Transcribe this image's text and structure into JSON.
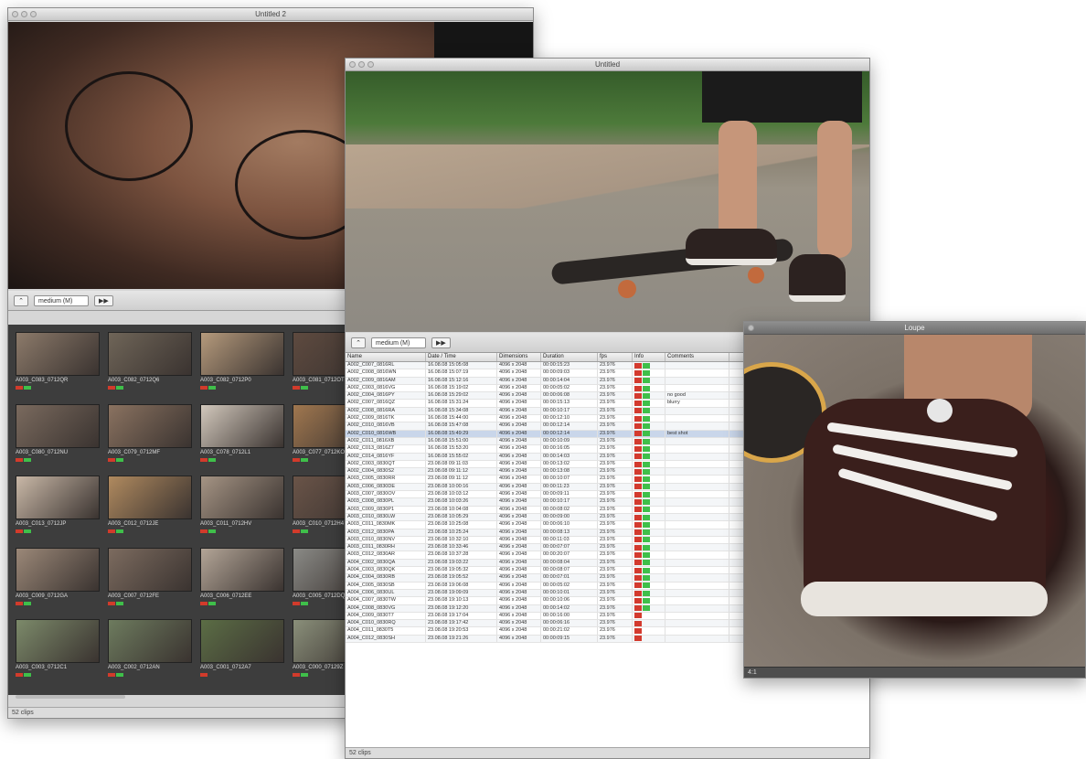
{
  "window1": {
    "title": "Untitled 2",
    "toolbar": {
      "btn1": "⌃",
      "size": "medium (M)",
      "btn2": "▶▶"
    },
    "clips": [
      {
        "name": "A003_C083_0712QR",
        "tags": [
          "r",
          "g"
        ]
      },
      {
        "name": "A003_C082_0712Q6",
        "tags": [
          "r",
          "g"
        ]
      },
      {
        "name": "A003_C082_0712P0",
        "tags": [
          "r",
          "g"
        ]
      },
      {
        "name": "A003_C081_0712OT",
        "tags": [
          "r",
          "g"
        ]
      },
      {
        "name": "A003_C080_0712NU",
        "tags": [
          "r",
          "g"
        ]
      },
      {
        "name": "A003_C079_0712MF",
        "tags": [
          "r",
          "g"
        ]
      },
      {
        "name": "A003_C078_0712L1",
        "tags": [
          "r",
          "g"
        ]
      },
      {
        "name": "A003_C077_0712KO",
        "tags": [
          "r",
          "g"
        ]
      },
      {
        "name": "A003_C013_0712JP",
        "tags": [
          "r",
          "g"
        ]
      },
      {
        "name": "A003_C012_0712JE",
        "tags": [
          "r",
          "g"
        ]
      },
      {
        "name": "A003_C011_0712HV",
        "tags": [
          "r",
          "g"
        ]
      },
      {
        "name": "A003_C010_0712H4",
        "tags": [
          "r",
          "g"
        ]
      },
      {
        "name": "A003_C009_0712GA",
        "tags": [
          "r",
          "g"
        ]
      },
      {
        "name": "A003_C007_0712FE",
        "tags": [
          "r",
          "g"
        ]
      },
      {
        "name": "A003_C006_0712EE",
        "tags": [
          "r",
          "g"
        ]
      },
      {
        "name": "A003_C005_0712DQ",
        "tags": [
          "r",
          "g"
        ]
      },
      {
        "name": "A003_C003_0712C1",
        "tags": [
          "r",
          "g"
        ]
      },
      {
        "name": "A003_C002_0712AN",
        "tags": [
          "r",
          "g"
        ]
      },
      {
        "name": "A003_C001_0712A7",
        "tags": [
          "r"
        ]
      },
      {
        "name": "A003_C000_07129Z",
        "tags": [
          "r",
          "g"
        ]
      }
    ],
    "status": "52 clips"
  },
  "window2": {
    "title": "Untitled",
    "toolbar": {
      "btn1": "⌃",
      "size": "medium (M)",
      "btn2": "▶▶"
    },
    "columns": [
      "Name",
      "Date / Time",
      "Dimensions",
      "Duration",
      "fps",
      "Info",
      "Comments"
    ],
    "rows": [
      {
        "name": "A002_C007_0816RL",
        "date": "16.08.08 15:05:08",
        "dim": "4096 x 2048",
        "dur": "00:00:15:23",
        "fps": "23.976",
        "tags": [
          "r",
          "g"
        ],
        "comment": ""
      },
      {
        "name": "A002_C008_0816WN",
        "date": "16.08.08 15:07:19",
        "dim": "4096 x 2048",
        "dur": "00:00:09:03",
        "fps": "23.976",
        "tags": [
          "r",
          "g"
        ],
        "comment": ""
      },
      {
        "name": "A002_C009_0816AM",
        "date": "16.08.08 15:12:16",
        "dim": "4096 x 2048",
        "dur": "00:00:14:04",
        "fps": "23.976",
        "tags": [
          "r",
          "g"
        ],
        "comment": ""
      },
      {
        "name": "A002_C003_0816VG",
        "date": "16.08.08 15:19:02",
        "dim": "4096 x 2048",
        "dur": "00:00:05:02",
        "fps": "23.976",
        "tags": [
          "r",
          "g"
        ],
        "comment": ""
      },
      {
        "name": "A002_C004_0816PY",
        "date": "16.08.08 15:29:02",
        "dim": "4096 x 2048",
        "dur": "00:00:06:08",
        "fps": "23.976",
        "tags": [
          "r",
          "g"
        ],
        "comment": "no good"
      },
      {
        "name": "A002_C007_0816QZ",
        "date": "16.08.08 15:31:24",
        "dim": "4096 x 2048",
        "dur": "00:00:15:13",
        "fps": "23.976",
        "tags": [
          "r",
          "g"
        ],
        "comment": "blurry"
      },
      {
        "name": "A002_C008_0816RA",
        "date": "16.08.08 15:34:08",
        "dim": "4096 x 2048",
        "dur": "00:00:10:17",
        "fps": "23.976",
        "tags": [
          "r",
          "g"
        ],
        "comment": ""
      },
      {
        "name": "A002_C009_0816TK",
        "date": "16.08.08 15:44:00",
        "dim": "4096 x 2048",
        "dur": "00:00:12:10",
        "fps": "23.976",
        "tags": [
          "r",
          "g"
        ],
        "comment": ""
      },
      {
        "name": "A002_C010_0816VB",
        "date": "16.08.08 15:47:08",
        "dim": "4096 x 2048",
        "dur": "00:00:12:14",
        "fps": "23.976",
        "tags": [
          "r",
          "g"
        ],
        "comment": ""
      },
      {
        "name": "A002_C010_0816WB",
        "date": "16.08.08 15:49:29",
        "dim": "4096 x 2048",
        "dur": "00:00:12:14",
        "fps": "23.976",
        "tags": [
          "r",
          "g"
        ],
        "comment": "best shot",
        "selected": true
      },
      {
        "name": "A002_C011_0816XB",
        "date": "16.08.08 15:51:00",
        "dim": "4096 x 2048",
        "dur": "00:00:10:09",
        "fps": "23.976",
        "tags": [
          "r",
          "g"
        ],
        "comment": ""
      },
      {
        "name": "A002_C013_0816Z7",
        "date": "16.08.08 15:53:20",
        "dim": "4096 x 2048",
        "dur": "00:00:16:05",
        "fps": "23.976",
        "tags": [
          "r",
          "g"
        ],
        "comment": ""
      },
      {
        "name": "A002_C014_0816YF",
        "date": "16.08.08 15:55:02",
        "dim": "4096 x 2048",
        "dur": "00:00:14:03",
        "fps": "23.976",
        "tags": [
          "r",
          "g"
        ],
        "comment": ""
      },
      {
        "name": "A002_C003_0830QT",
        "date": "23.08.08 09:11:03",
        "dim": "4096 x 2048",
        "dur": "00:00:13:02",
        "fps": "23.976",
        "tags": [
          "r",
          "g"
        ],
        "comment": ""
      },
      {
        "name": "A002_C004_0830S2",
        "date": "23.08.08 09:11:12",
        "dim": "4096 x 2048",
        "dur": "00:00:13:08",
        "fps": "23.976",
        "tags": [
          "r",
          "g"
        ],
        "comment": ""
      },
      {
        "name": "A003_C005_0830RR",
        "date": "23.08.08 09:11:12",
        "dim": "4096 x 2048",
        "dur": "00:00:10:07",
        "fps": "23.976",
        "tags": [
          "r",
          "g"
        ],
        "comment": ""
      },
      {
        "name": "A003_C006_0830DE",
        "date": "23.08.08 10:00:16",
        "dim": "4096 x 2048",
        "dur": "00:00:11:23",
        "fps": "23.976",
        "tags": [
          "r",
          "g"
        ],
        "comment": ""
      },
      {
        "name": "A003_C007_0830OV",
        "date": "23.08.08 10:03:12",
        "dim": "4096 x 2048",
        "dur": "00:00:09:11",
        "fps": "23.976",
        "tags": [
          "r",
          "g"
        ],
        "comment": ""
      },
      {
        "name": "A003_C008_0830PL",
        "date": "23.08.08 10:03:26",
        "dim": "4096 x 2048",
        "dur": "00:00:10:17",
        "fps": "23.976",
        "tags": [
          "r",
          "g"
        ],
        "comment": ""
      },
      {
        "name": "A003_C009_0830P1",
        "date": "23.08.08 10:04:08",
        "dim": "4096 x 2048",
        "dur": "00:00:08:02",
        "fps": "23.976",
        "tags": [
          "r",
          "g"
        ],
        "comment": ""
      },
      {
        "name": "A003_C010_0830LW",
        "date": "23.08.08 10:05:29",
        "dim": "4096 x 2048",
        "dur": "00:00:09:00",
        "fps": "23.976",
        "tags": [
          "r",
          "g"
        ],
        "comment": ""
      },
      {
        "name": "A003_C011_0830MK",
        "date": "23.08.08 10:25:08",
        "dim": "4096 x 2048",
        "dur": "00:00:06:10",
        "fps": "23.976",
        "tags": [
          "r",
          "g"
        ],
        "comment": ""
      },
      {
        "name": "A003_C012_0830PA",
        "date": "23.08.08 10:25:24",
        "dim": "4096 x 2048",
        "dur": "00:00:08:13",
        "fps": "23.976",
        "tags": [
          "r",
          "g"
        ],
        "comment": ""
      },
      {
        "name": "A003_C010_0830NV",
        "date": "23.08.08 10:32:10",
        "dim": "4096 x 2048",
        "dur": "00:00:11:03",
        "fps": "23.976",
        "tags": [
          "r",
          "g"
        ],
        "comment": ""
      },
      {
        "name": "A003_C011_0830RH",
        "date": "23.08.08 10:33:46",
        "dim": "4096 x 2048",
        "dur": "00:00:07:07",
        "fps": "23.976",
        "tags": [
          "r",
          "g"
        ],
        "comment": ""
      },
      {
        "name": "A003_C012_0830AR",
        "date": "23.08.08 10:37:28",
        "dim": "4096 x 2048",
        "dur": "00:00:20:07",
        "fps": "23.976",
        "tags": [
          "r",
          "g"
        ],
        "comment": ""
      },
      {
        "name": "A004_C002_0830QA",
        "date": "23.08.08 19:03:22",
        "dim": "4096 x 2048",
        "dur": "00:00:08:04",
        "fps": "23.976",
        "tags": [
          "r",
          "g"
        ],
        "comment": ""
      },
      {
        "name": "A004_C003_0830QK",
        "date": "23.08.08 19:05:32",
        "dim": "4096 x 2048",
        "dur": "00:00:08:07",
        "fps": "23.976",
        "tags": [
          "r",
          "g"
        ],
        "comment": ""
      },
      {
        "name": "A004_C004_0830RB",
        "date": "23.08.08 19:05:52",
        "dim": "4096 x 2048",
        "dur": "00:00:07:01",
        "fps": "23.976",
        "tags": [
          "r",
          "g"
        ],
        "comment": ""
      },
      {
        "name": "A004_C005_0830SB",
        "date": "23.08.08 19:06:08",
        "dim": "4096 x 2048",
        "dur": "00:00:05:02",
        "fps": "23.976",
        "tags": [
          "r",
          "g"
        ],
        "comment": ""
      },
      {
        "name": "A004_C006_0830UL",
        "date": "23.08.08 19:09:09",
        "dim": "4096 x 2048",
        "dur": "00:00:10:01",
        "fps": "23.976",
        "tags": [
          "r",
          "g"
        ],
        "comment": ""
      },
      {
        "name": "A004_C007_0830TW",
        "date": "23.08.08 19:10:13",
        "dim": "4096 x 2048",
        "dur": "00:00:10:06",
        "fps": "23.976",
        "tags": [
          "r",
          "g"
        ],
        "comment": ""
      },
      {
        "name": "A004_C008_0830VG",
        "date": "23.08.08 19:12:20",
        "dim": "4096 x 2048",
        "dur": "00:00:14:02",
        "fps": "23.976",
        "tags": [
          "r",
          "g"
        ],
        "comment": ""
      },
      {
        "name": "A004_C009_0830T7",
        "date": "23.08.08 19:17:04",
        "dim": "4096 x 2048",
        "dur": "00:00:16:00",
        "fps": "23.976",
        "tags": [
          "r"
        ],
        "comment": ""
      },
      {
        "name": "A004_C010_0830RQ",
        "date": "23.08.08 19:17:42",
        "dim": "4096 x 2048",
        "dur": "00:00:06:16",
        "fps": "23.976",
        "tags": [
          "r"
        ],
        "comment": ""
      },
      {
        "name": "A004_C011_0830T5",
        "date": "23.08.08 19:20:53",
        "dim": "4096 x 2048",
        "dur": "00:00:21:02",
        "fps": "23.976",
        "tags": [
          "r"
        ],
        "comment": ""
      },
      {
        "name": "A004_C012_0830SH",
        "date": "23.08.08 19:21:26",
        "dim": "4096 x 2048",
        "dur": "00:00:09:15",
        "fps": "23.976",
        "tags": [
          "r"
        ],
        "comment": ""
      }
    ],
    "status": "52 clips"
  },
  "window3": {
    "title": "Loupe",
    "status": "4:1"
  },
  "colors": {
    "tag_red": "#d23b2b",
    "tag_green": "#3fbf4a",
    "selection": "#c9d6ea"
  }
}
